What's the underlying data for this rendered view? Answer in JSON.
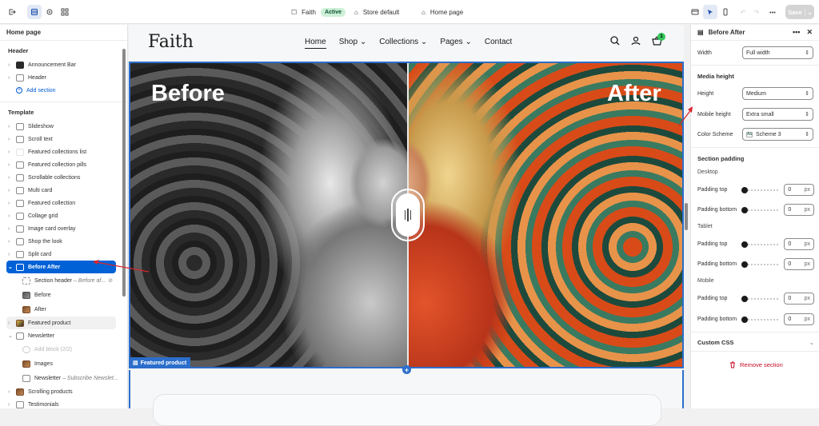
{
  "topbar": {
    "store_name": "Faith",
    "status_badge": "Active",
    "store_default": "Store default",
    "page": "Home page",
    "save_label": "Save"
  },
  "left": {
    "title": "Home page",
    "header_group": "Header",
    "header_items": [
      "Announcement Bar",
      "Header"
    ],
    "add_section": "Add section",
    "template_group": "Template",
    "template_items": [
      "Slideshow",
      "Scroll text",
      "Featured collections list",
      "Featured collection pills",
      "Scrollable collections",
      "Multi card",
      "Featured collection",
      "Collage grid",
      "Image card overlay",
      "Shop the look",
      "Split card"
    ],
    "selected_item": "Before After",
    "children": {
      "section_header": "Section header",
      "section_header_em": "– Before af...",
      "before": "Before",
      "after": "After"
    },
    "featured_product": "Featured product",
    "newsletter": "Newsletter",
    "newsletter_children": {
      "add_block": "Add block (2/2)",
      "images": "Images",
      "newsletter_block": "Newsletter",
      "newsletter_em": "– Subscribe Newslet..."
    },
    "more_items": [
      "Scrolling products",
      "Testimonials"
    ]
  },
  "store": {
    "logo": "Faith",
    "nav": [
      "Home",
      "Shop",
      "Collections",
      "Pages",
      "Contact"
    ],
    "cart_count": "1",
    "before_label": "Before",
    "after_label": "After",
    "featured_tag": "Featured product"
  },
  "right": {
    "title": "Before After",
    "width_label": "Width",
    "width_value": "Full width",
    "media_height_title": "Media height",
    "height_label": "Height",
    "height_value": "Medium",
    "mobile_height_label": "Mobile height",
    "mobile_height_value": "Extra small",
    "color_scheme_label": "Color Scheme",
    "color_scheme_value": "Scheme 3",
    "swatch_text": "Aa",
    "section_padding_title": "Section padding",
    "desktop": "Desktop",
    "tablet": "Tablet",
    "mobile": "Mobile",
    "padding_top": "Padding top",
    "padding_bottom": "Padding bottom",
    "padding_value": "0",
    "unit": "px",
    "custom_css": "Custom CSS",
    "remove_section": "Remove section"
  },
  "colors": {
    "accent": "#0061d6",
    "selection_outline": "#2c6ecb",
    "active_badge_bg": "#cdf0d6",
    "remove": "#c70a24",
    "annotation_arrow": "#d9262e"
  }
}
